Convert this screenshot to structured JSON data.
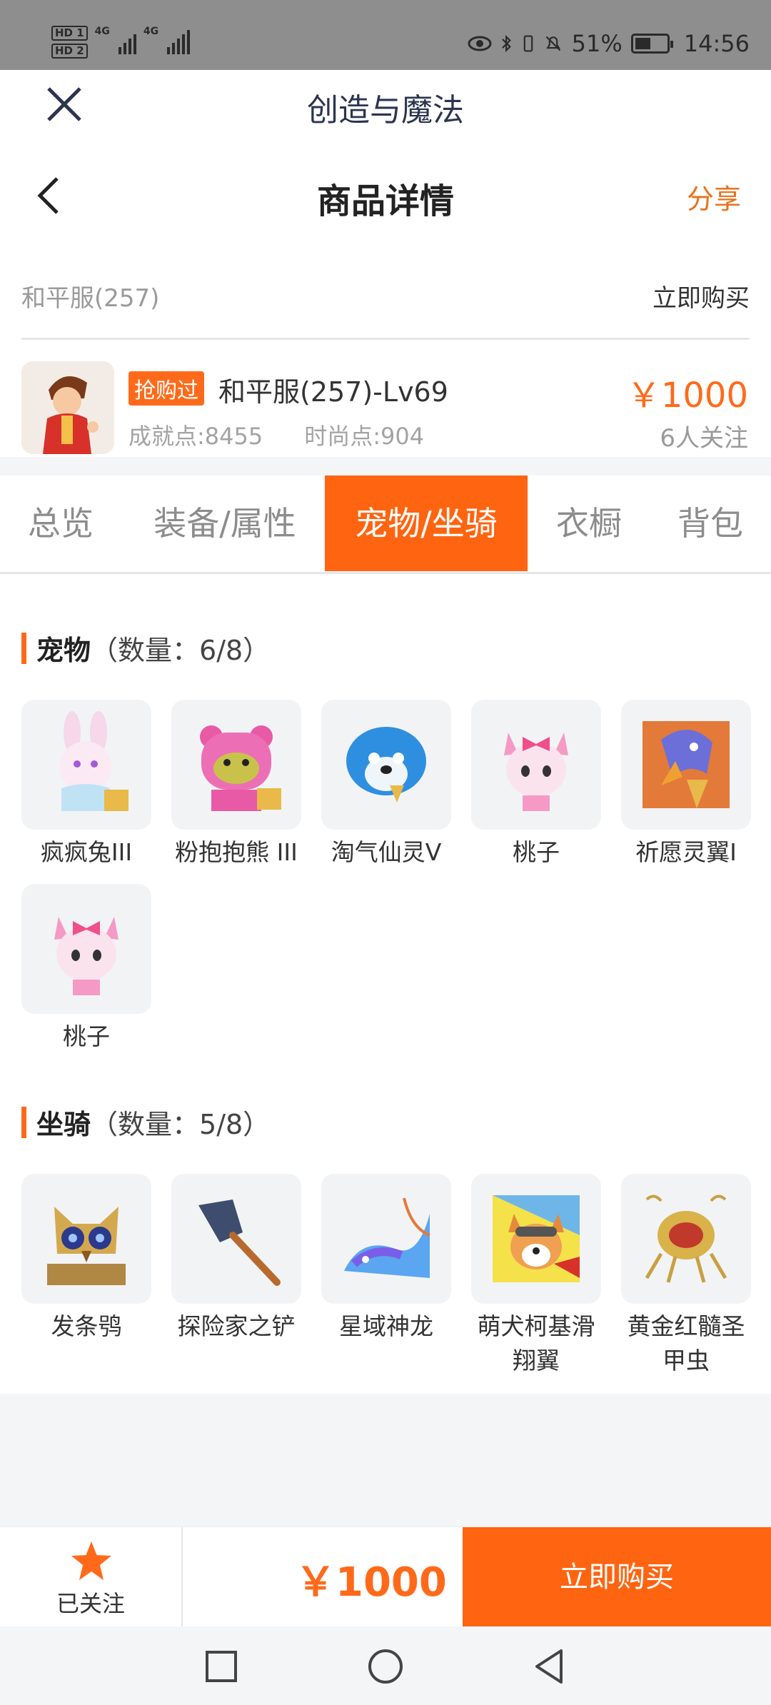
{
  "status_bar": {
    "hd1": "HD 1",
    "hd2": "HD 2",
    "sig1": "4G",
    "sig2": "4G",
    "battery_percent": "51%",
    "battery_level": 0.51,
    "time": "14:56"
  },
  "app": {
    "title": "创造与魔法"
  },
  "header": {
    "title": "商品详情",
    "share_label": "分享"
  },
  "server": {
    "name": "和平服(257)",
    "buy_link": "立即购买"
  },
  "product": {
    "tag": "抢购过",
    "name": "和平服(257)-Lv69",
    "achievement": "成就点:8455",
    "fashion": "时尚点:904",
    "price": "￥1000",
    "followers": "6人关注"
  },
  "tabs": [
    {
      "label": "总览"
    },
    {
      "label": "装备/属性"
    },
    {
      "label": "宠物/坐骑",
      "active": true
    },
    {
      "label": "衣橱"
    },
    {
      "label": "背包"
    }
  ],
  "pets": {
    "title": "宠物",
    "count": "（数量：6/8）",
    "items": [
      {
        "name": "疯疯兔III",
        "icon": "rabbit-icon"
      },
      {
        "name": "粉抱抱熊 III",
        "icon": "bear-icon"
      },
      {
        "name": "淘气仙灵V",
        "icon": "seal-icon"
      },
      {
        "name": "桃子",
        "icon": "pink-cat-icon"
      },
      {
        "name": "祈愿灵翼I",
        "icon": "eagle-icon"
      },
      {
        "name": "桃子",
        "icon": "pink-cat-icon"
      }
    ]
  },
  "mounts": {
    "title": "坐骑",
    "count": "（数量：5/8）",
    "items": [
      {
        "name": "发条鸮",
        "icon": "owl-icon"
      },
      {
        "name": "探险家之铲",
        "icon": "shovel-icon"
      },
      {
        "name": "星域神龙",
        "icon": "dragon-icon"
      },
      {
        "name": "萌犬柯基滑翔翼",
        "icon": "corgi-icon"
      },
      {
        "name": "黄金红髓圣甲虫",
        "icon": "beetle-icon"
      }
    ]
  },
  "bottom": {
    "follow_label": "已关注",
    "price": "￥1000",
    "buy_label": "立即购买"
  },
  "colors": {
    "accent": "#ff6410",
    "price": "#ff6a1a",
    "band": "#f4f5f7"
  }
}
